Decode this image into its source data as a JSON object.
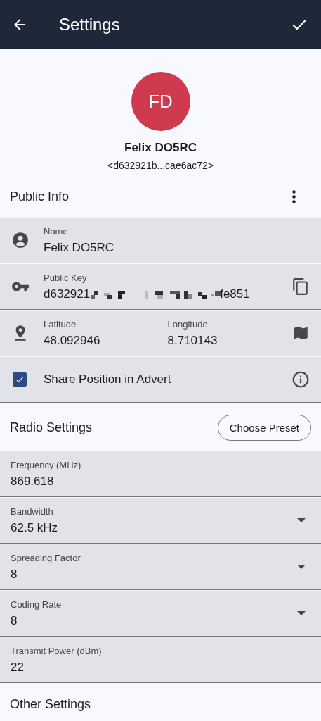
{
  "app_bar": {
    "title": "Settings"
  },
  "profile": {
    "initials": "FD",
    "name": "Felix DO5RC",
    "key_short": "<d632921b...cae6ac72>"
  },
  "public_info": {
    "title": "Public Info",
    "fields": [
      {
        "kind": "text",
        "label": "Name",
        "value": "Felix DO5RC"
      },
      {
        "kind": "key",
        "label": "Public Key",
        "value_start": "d632921",
        "value_end": "fe851"
      },
      {
        "kind": "location",
        "label": "Latitude",
        "value": "48.092946",
        "label_2": "Longitude",
        "value_2": "8.710143"
      },
      {
        "kind": "checkbox",
        "label": "Share Position in Advert",
        "checked": true
      }
    ]
  },
  "radio_settings": {
    "title": "Radio Settings",
    "button": "Choose Preset",
    "fields": [
      {
        "kind": "text",
        "label": "Frequency (MHz)",
        "value": "869.618"
      },
      {
        "kind": "dropdown",
        "label": "Bandwidth",
        "value": "62.5 kHz"
      },
      {
        "kind": "dropdown",
        "label": "Spreading Factor",
        "value": "8"
      },
      {
        "kind": "dropdown",
        "label": "Coding Rate",
        "value": "8"
      },
      {
        "kind": "text",
        "label": "Transmit Power (dBm)",
        "value": "22"
      }
    ]
  },
  "other_settings": {
    "title": "Other Settings"
  }
}
